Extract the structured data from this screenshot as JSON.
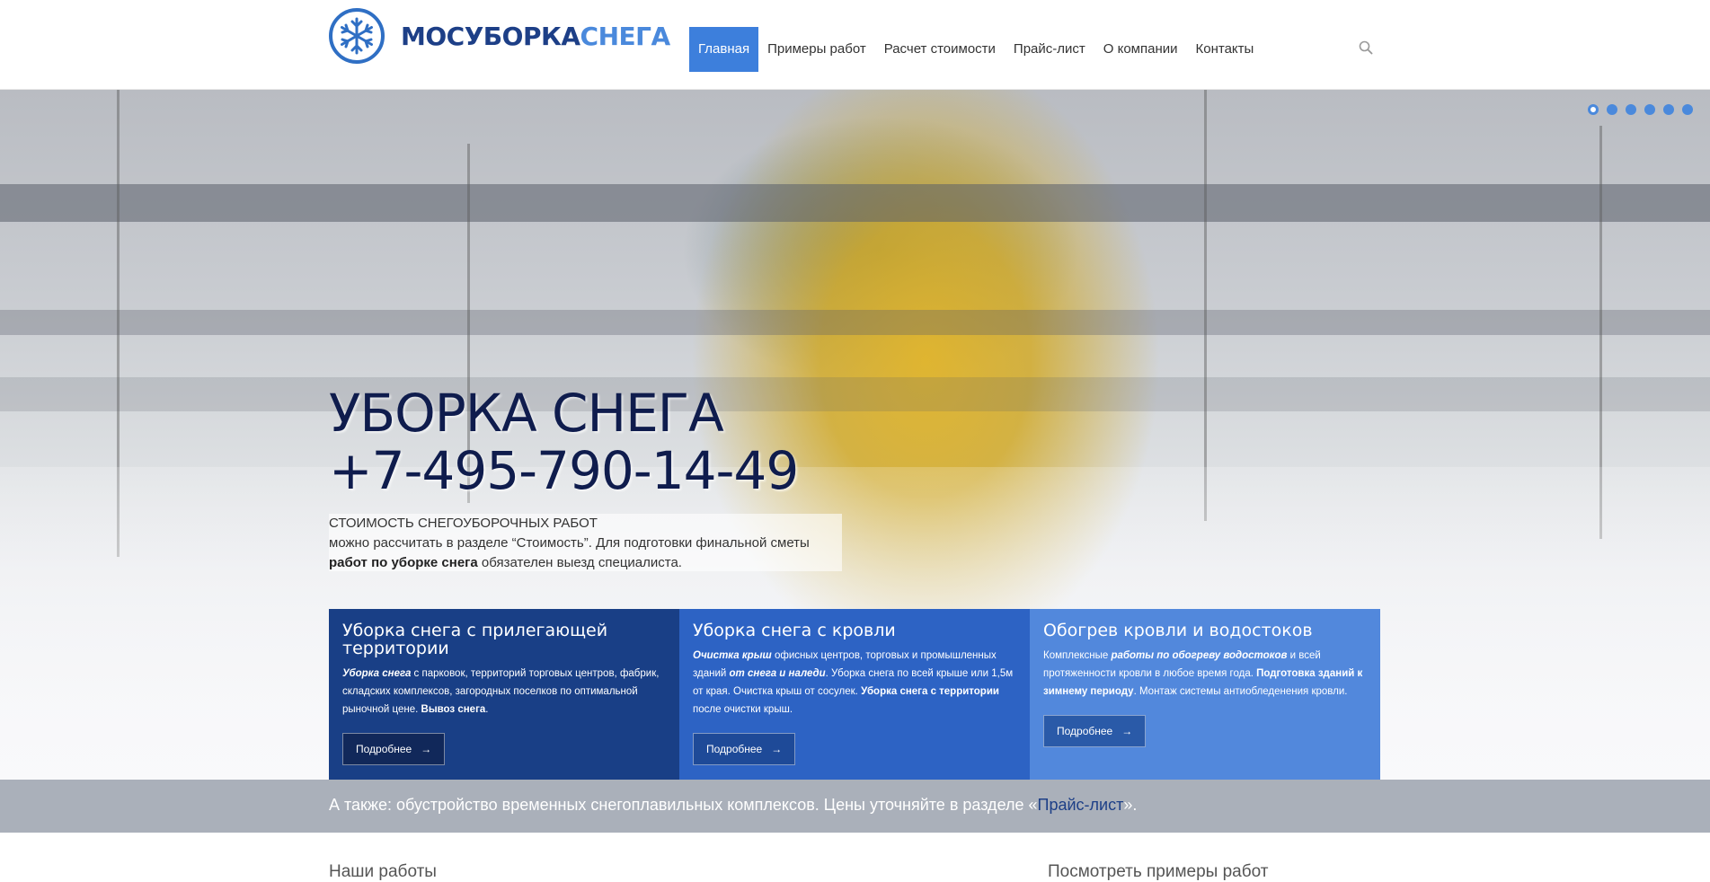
{
  "header": {
    "logo": {
      "dark": "МОСУБОРКА",
      "light": "СНЕГА",
      "icon": "snowflake-icon"
    },
    "nav": [
      {
        "label": "Главная",
        "active": true
      },
      {
        "label": "Примеры работ"
      },
      {
        "label": "Расчет стоимости"
      },
      {
        "label": "Прайс-лист"
      },
      {
        "label": "О компании"
      },
      {
        "label": "Контакты"
      }
    ],
    "search_icon": "search-icon"
  },
  "hero": {
    "title_line1": "УБОРКА СНЕГА",
    "title_line2": "+7-495-790-14-49",
    "text_line1": "СТОИМОСТЬ СНЕГОУБОРОЧНЫХ РАБОТ",
    "text_line2": "можно рассчитать в разделе “Стоимость”. Для подготовки финальной сметы",
    "text_line3_bold": "работ по уборке снега",
    "text_line3_rest": " обязателен выезд специалиста.",
    "slides_count": 6,
    "active_slide": 1
  },
  "cards": [
    {
      "title": "Уборка снега с прилегающей территории",
      "t1_bi": "Уборка снега",
      "t2": " с парковок, территорий торговых центров, фабрик, складских комплексов, загородных поселков по оптимальной рыночной цене. ",
      "t3_b": "Вывоз снега",
      "t4": ".",
      "button": "Подробнее"
    },
    {
      "title": "Уборка снега с кровли",
      "t1_bi": "Очистка крыш",
      "t2": " офисных центров, торговых и промышленных зданий ",
      "t3_bi": "от снега и наледи",
      "t4": ". Уборка снега по всей крыше или 1,5м от края. Очистка крыш от сосулек. ",
      "t5_b": "Уборка снега с территории",
      "t6": " после очистки крыш.",
      "button": "Подробнее"
    },
    {
      "title": "Обогрев кровли и водостоков",
      "t1": "Комплексные ",
      "t2_bi": "работы по обогреву водостоков",
      "t3": " и всей протяженности кровли в любое время года. ",
      "t4_b": "Подготовка зданий к зимнему периоду",
      "t5": ". Монтаж системы антиобледенения кровли.",
      "button": "Подробнее"
    }
  ],
  "banner": {
    "text": "А также: обустройство временных снегоплавильных комплексов. Цены уточняйте в разделе «",
    "link": "Прайс-лист",
    "tail": "»."
  },
  "bottom": {
    "left": "Наши работы",
    "right": "Посмотреть примеры работ"
  },
  "colors": {
    "brand_dark": "#1d3f87",
    "brand_light": "#4a89dc",
    "card1": "#193f86",
    "card2": "#2d63c4",
    "card3": "#5288dc"
  }
}
